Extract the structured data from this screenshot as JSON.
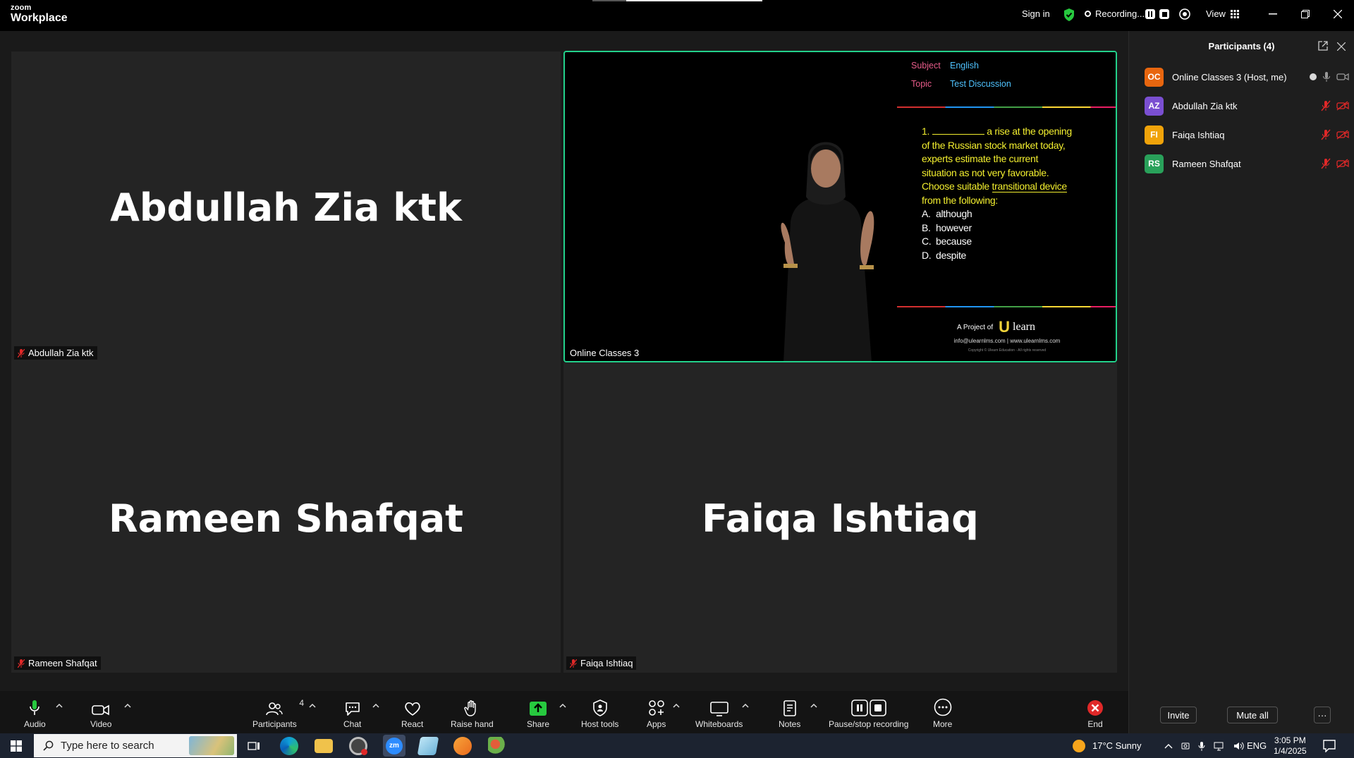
{
  "app": {
    "logo_top": "zoom",
    "logo_bottom": "Workplace",
    "sign_in": "Sign in",
    "recording_label": "Recording...",
    "view_label": "View"
  },
  "tiles": {
    "abdullah": {
      "big_name": "Abdullah Zia ktk",
      "label": "Abdullah Zia ktk"
    },
    "rameen": {
      "big_name": "Rameen Shafqat",
      "label": "Rameen Shafqat"
    },
    "faiqa": {
      "big_name": "Faiqa Ishtiaq",
      "label": "Faiqa Ishtiaq"
    },
    "share": {
      "label": "Online Classes 3"
    }
  },
  "slide": {
    "subject_key": "Subject",
    "subject_val": "English",
    "topic_key": "Topic",
    "topic_val": "Test Discussion",
    "q_num": "1.",
    "q_line1": "a rise at the opening",
    "q_line2": "of the Russian stock market today,",
    "q_line3": "experts estimate the current",
    "q_line4": "situation as not very favorable.",
    "q_line5a": "Choose suitable ",
    "q_line5b": "transitional device",
    "q_line6": "from the following:",
    "options": [
      {
        "letter": "A.",
        "text": "although"
      },
      {
        "letter": "B.",
        "text": "however"
      },
      {
        "letter": "C.",
        "text": "because"
      },
      {
        "letter": "D.",
        "text": "despite"
      }
    ],
    "project_of": "A Project of",
    "brand": "learn",
    "brand_letter": "U",
    "contact": "info@ulearnlms.com | www.ulearnlms.com",
    "copyright": "Copyright © Ulearn Education - All rights reserved"
  },
  "panel": {
    "title": "Participants (4)",
    "participants": [
      {
        "initials": "OC",
        "name": "Online Classes 3 (Host, me)",
        "color": "#e8660f"
      },
      {
        "initials": "AZ",
        "name": "Abdullah Zia ktk",
        "color": "#7a4fd1"
      },
      {
        "initials": "FI",
        "name": "Faiqa Ishtiaq",
        "color": "#f0a30a"
      },
      {
        "initials": "RS",
        "name": "Rameen Shafqat",
        "color": "#29a15a"
      }
    ],
    "invite": "Invite",
    "mute_all": "Mute all",
    "more": "···"
  },
  "toolbar": {
    "audio": "Audio",
    "video": "Video",
    "participants": "Participants",
    "participants_count": "4",
    "chat": "Chat",
    "react": "React",
    "raise_hand": "Raise hand",
    "share": "Share",
    "host_tools": "Host tools",
    "apps": "Apps",
    "whiteboards": "Whiteboards",
    "notes": "Notes",
    "pause_stop": "Pause/stop recording",
    "more": "More",
    "end": "End"
  },
  "taskbar": {
    "search_placeholder": "Type here to search",
    "weather": "17°C  Sunny",
    "language": "ENG",
    "time": "3:05 PM",
    "date": "1/4/2025"
  },
  "colors": {
    "active_speaker": "#23d18b",
    "recording_green": "#27c93f",
    "end_red": "#e02828",
    "muted_red": "#e02828",
    "slide_key": "#e85c8a",
    "slide_val": "#4fc3ff",
    "slide_text": "#f2ee2f"
  }
}
